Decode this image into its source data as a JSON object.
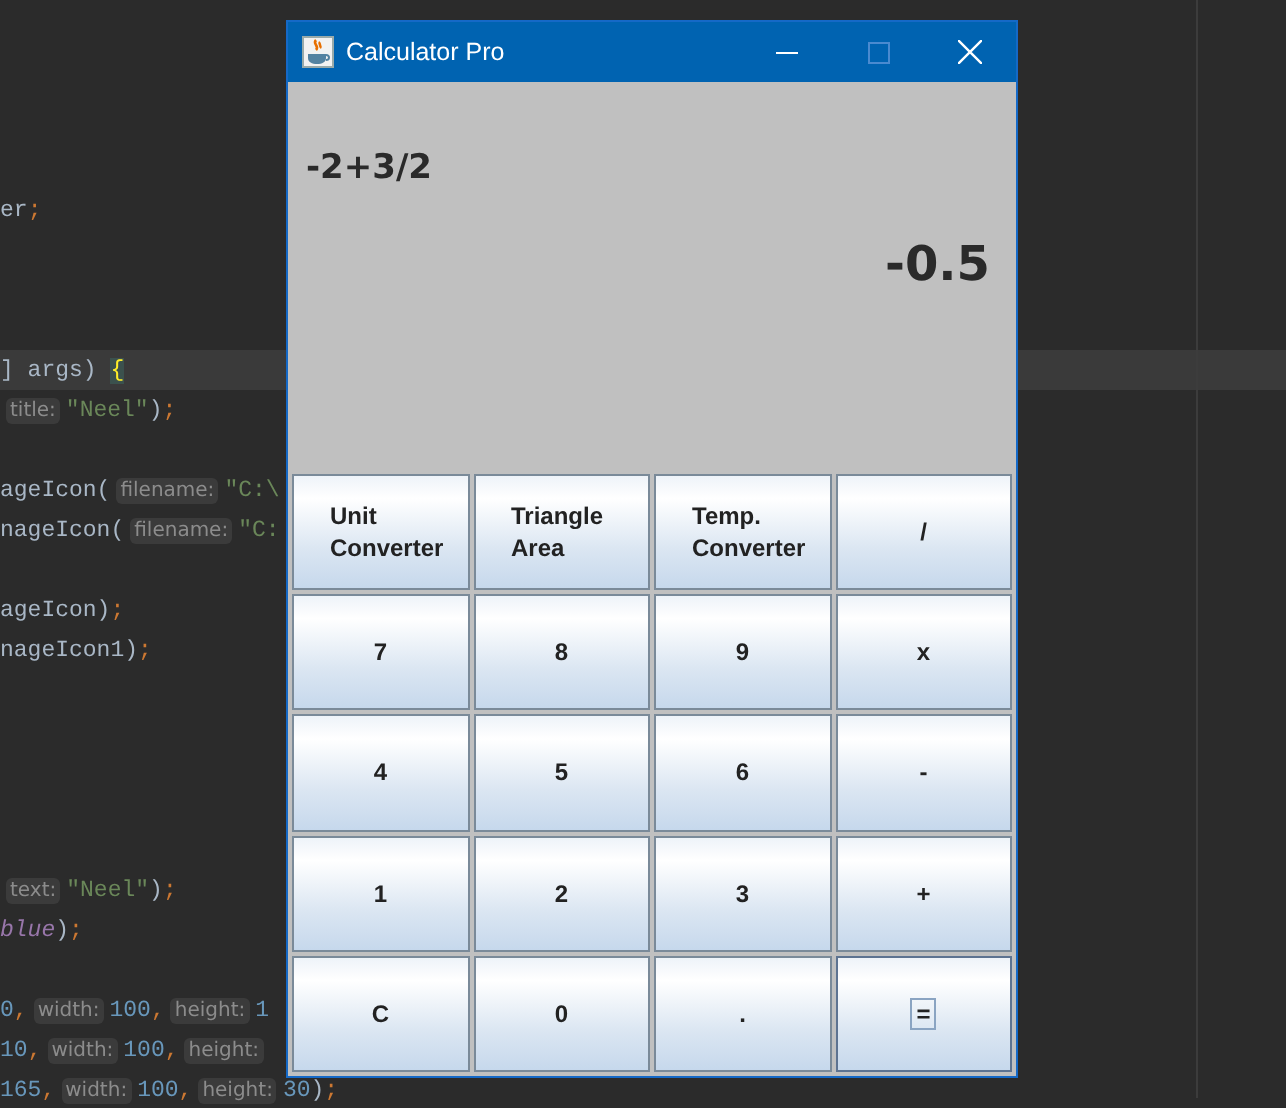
{
  "editor": {
    "lines": [
      {
        "current": false,
        "segments": [
          {
            "kind": "plain",
            "text": "er"
          },
          {
            "kind": "punct",
            "text": ";"
          }
        ]
      },
      {
        "current": true,
        "segments": [
          {
            "kind": "plain",
            "text": "] args) "
          },
          {
            "kind": "brace",
            "text": "{"
          }
        ]
      },
      {
        "current": false,
        "segments": [
          {
            "kind": "hint",
            "text": "title:"
          },
          {
            "kind": "string",
            "text": "\"Neel\""
          },
          {
            "kind": "plain",
            "text": ")"
          },
          {
            "kind": "punct",
            "text": ";"
          }
        ]
      },
      {
        "current": false,
        "segments": [
          {
            "kind": "plain",
            "text": "ageIcon("
          },
          {
            "kind": "hint",
            "text": "filename:"
          },
          {
            "kind": "string",
            "text": "\"C:\\"
          }
        ]
      },
      {
        "current": false,
        "segments": [
          {
            "kind": "plain",
            "text": "nageIcon("
          },
          {
            "kind": "hint",
            "text": "filename:"
          },
          {
            "kind": "string",
            "text": "\"C:"
          }
        ]
      },
      {
        "current": false,
        "segments": [
          {
            "kind": "plain",
            "text": "ageIcon)"
          },
          {
            "kind": "punct",
            "text": ";"
          }
        ]
      },
      {
        "current": false,
        "segments": [
          {
            "kind": "plain",
            "text": "nageIcon1)"
          },
          {
            "kind": "punct",
            "text": ";"
          }
        ]
      },
      {
        "current": false,
        "segments": [
          {
            "kind": "hint",
            "text": "text:"
          },
          {
            "kind": "string",
            "text": "\"Neel\""
          },
          {
            "kind": "plain",
            "text": ")"
          },
          {
            "kind": "punct",
            "text": ";"
          }
        ]
      },
      {
        "current": false,
        "segments": [
          {
            "kind": "field",
            "text": "blue"
          },
          {
            "kind": "plain",
            "text": ")"
          },
          {
            "kind": "punct",
            "text": ";"
          }
        ]
      },
      {
        "current": false,
        "segments": [
          {
            "kind": "number",
            "text": "0"
          },
          {
            "kind": "punct",
            "text": ","
          },
          {
            "kind": "hint",
            "text": "width:"
          },
          {
            "kind": "number",
            "text": "100"
          },
          {
            "kind": "punct",
            "text": ","
          },
          {
            "kind": "hint",
            "text": "height:"
          },
          {
            "kind": "number",
            "text": "1"
          }
        ]
      },
      {
        "current": false,
        "segments": [
          {
            "kind": "number",
            "text": "10"
          },
          {
            "kind": "punct",
            "text": ","
          },
          {
            "kind": "hint",
            "text": "width:"
          },
          {
            "kind": "number",
            "text": "100"
          },
          {
            "kind": "punct",
            "text": ","
          },
          {
            "kind": "hint",
            "text": "height:"
          }
        ]
      },
      {
        "current": false,
        "segments": [
          {
            "kind": "number",
            "text": "165"
          },
          {
            "kind": "punct",
            "text": ","
          },
          {
            "kind": "hint",
            "text": "width:"
          },
          {
            "kind": "number",
            "text": "100"
          },
          {
            "kind": "punct",
            "text": ","
          },
          {
            "kind": "hint",
            "text": "height:"
          },
          {
            "kind": "number",
            "text": "30"
          },
          {
            "kind": "plain",
            "text": ")"
          },
          {
            "kind": "punct",
            "text": ";"
          }
        ]
      }
    ]
  },
  "window": {
    "title": "Calculator Pro",
    "maximizable": false
  },
  "display": {
    "expression": "-2+3/2",
    "result": "-0.5"
  },
  "buttons": [
    {
      "label": "Unit\nConverter",
      "kind": "function",
      "focused": false
    },
    {
      "label": "Triangle\nArea",
      "kind": "function",
      "focused": false
    },
    {
      "label": "Temp.\nConverter",
      "kind": "function",
      "focused": false
    },
    {
      "label": "/",
      "kind": "key",
      "focused": false
    },
    {
      "label": "7",
      "kind": "key",
      "focused": false
    },
    {
      "label": "8",
      "kind": "key",
      "focused": false
    },
    {
      "label": "9",
      "kind": "key",
      "focused": false
    },
    {
      "label": "x",
      "kind": "key",
      "focused": false
    },
    {
      "label": "4",
      "kind": "key",
      "focused": false
    },
    {
      "label": "5",
      "kind": "key",
      "focused": false
    },
    {
      "label": "6",
      "kind": "key",
      "focused": false
    },
    {
      "label": "-",
      "kind": "key",
      "focused": false
    },
    {
      "label": "1",
      "kind": "key",
      "focused": false
    },
    {
      "label": "2",
      "kind": "key",
      "focused": false
    },
    {
      "label": "3",
      "kind": "key",
      "focused": false
    },
    {
      "label": "+",
      "kind": "key",
      "focused": false
    },
    {
      "label": "C",
      "kind": "key",
      "focused": false
    },
    {
      "label": "0",
      "kind": "key",
      "focused": false
    },
    {
      "label": ".",
      "kind": "key",
      "focused": false
    },
    {
      "label": "=",
      "kind": "key",
      "focused": true
    }
  ]
}
